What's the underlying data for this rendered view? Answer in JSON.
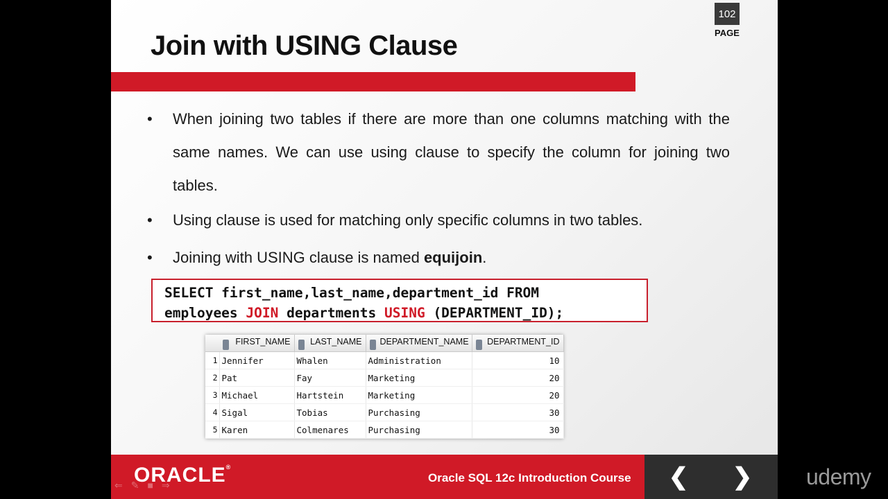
{
  "page": {
    "number": "102",
    "label": "PAGE"
  },
  "title": "Join with USING Clause",
  "bullets": {
    "b1": "When joining two tables if there are more than one columns matching with the same names. We can use using clause to specify the column for joining two tables.",
    "b2": "Using clause is used for matching only specific columns in two tables.",
    "b3_pre": "Joining with USING clause is named ",
    "b3_bold": "equijoin",
    "b3_post": "."
  },
  "code": {
    "line1": "SELECT first_name,last_name,department_id FROM",
    "l2_a": "employees ",
    "l2_kw1": "JOIN",
    "l2_b": " departments ",
    "l2_kw2": "USING",
    "l2_c": " (DEPARTMENT_ID);"
  },
  "result": {
    "columns": [
      "FIRST_NAME",
      "LAST_NAME",
      "DEPARTMENT_NAME",
      "DEPARTMENT_ID"
    ],
    "rows": [
      [
        "1",
        "Jennifer",
        "Whalen",
        "Administration",
        "10"
      ],
      [
        "2",
        "Pat",
        "Fay",
        "Marketing",
        "20"
      ],
      [
        "3",
        "Michael",
        "Hartstein",
        "Marketing",
        "20"
      ],
      [
        "4",
        "Sigal",
        "Tobias",
        "Purchasing",
        "30"
      ],
      [
        "5",
        "Karen",
        "Colmenares",
        "Purchasing",
        "30"
      ]
    ]
  },
  "footer": {
    "logo": "ORACLE",
    "logo_mark": "®",
    "course": "Oracle SQL 12c Introduction Course"
  },
  "nav": {
    "prev": "❮",
    "next": "❯",
    "prev_icon": "chevron-left-icon",
    "next_icon": "chevron-right-icon"
  },
  "watermark": "udemy",
  "colors": {
    "accent_red": "#d01a27",
    "dark_panel": "#2e2e2e"
  }
}
